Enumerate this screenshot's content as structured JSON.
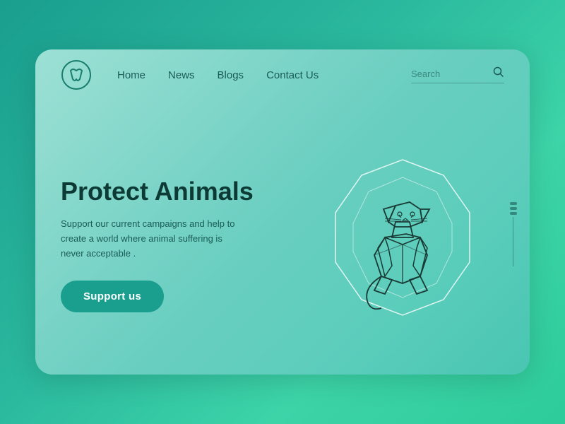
{
  "background": {
    "gradient_start": "#1a9e8e",
    "gradient_end": "#3dd4a8"
  },
  "navbar": {
    "logo_alt": "animal-protection-logo",
    "links": [
      {
        "label": "Home",
        "id": "home"
      },
      {
        "label": "News",
        "id": "news"
      },
      {
        "label": "Blogs",
        "id": "blogs"
      },
      {
        "label": "Contact Us",
        "id": "contact"
      }
    ],
    "search": {
      "placeholder": "Search",
      "icon": "🔍"
    }
  },
  "hero": {
    "title": "Protect Animals",
    "description": "Support our current campaigns and help to create a world where animal suffering is never acceptable .",
    "cta_label": "Support us"
  },
  "illustration": {
    "alt": "geometric-cat"
  }
}
